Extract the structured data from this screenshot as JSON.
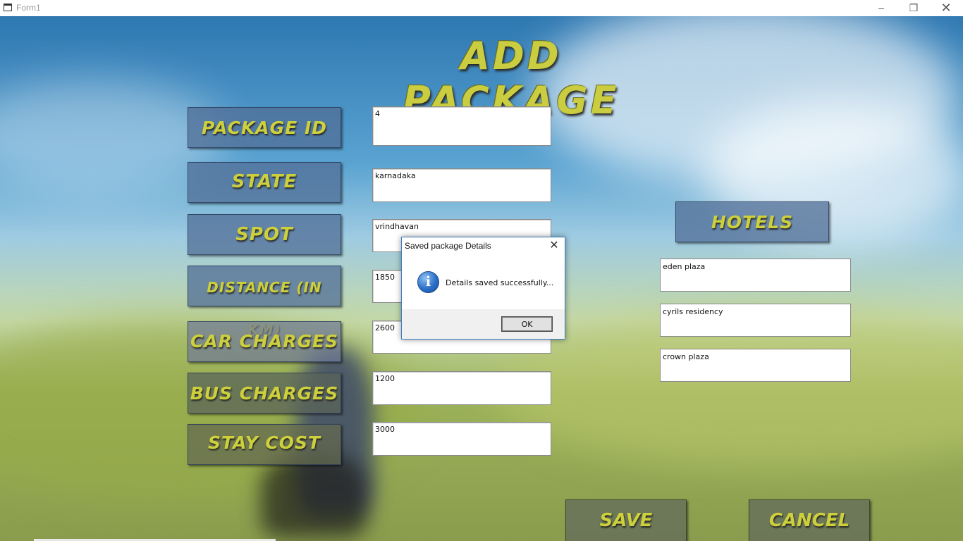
{
  "window": {
    "title": "Form1",
    "minimize": "–",
    "restore": "❐",
    "close": "✕"
  },
  "form": {
    "heading": "ADD PACKAGE",
    "labels": {
      "package_id": "PACKAGE ID",
      "state": "STATE",
      "spot": "SPOT",
      "distance": "DISTANCE (IN KM)",
      "car_charges": "CAR CHARGES",
      "bus_charges": "BUS CHARGES",
      "stay_cost": "STAY COST",
      "hotels": "HOTELS"
    },
    "values": {
      "package_id": "4",
      "state": "karnadaka",
      "spot": "vrindhavan",
      "distance": "1850",
      "car_charges": "2600",
      "bus_charges": "1200",
      "stay_cost": "3000"
    },
    "hotels": [
      "eden plaza",
      "cyrils residency",
      "crown plaza"
    ],
    "buttons": {
      "save": "SAVE",
      "cancel": "CANCEL"
    }
  },
  "dialog": {
    "title": "Saved  package Details",
    "message": "Details saved successfully...",
    "ok": "OK",
    "close": "✕",
    "icon": "info-icon"
  },
  "colors": {
    "label_text": "#cdd03c",
    "label_bg": "#506e96",
    "dialog_border": "#3c7fc0"
  }
}
